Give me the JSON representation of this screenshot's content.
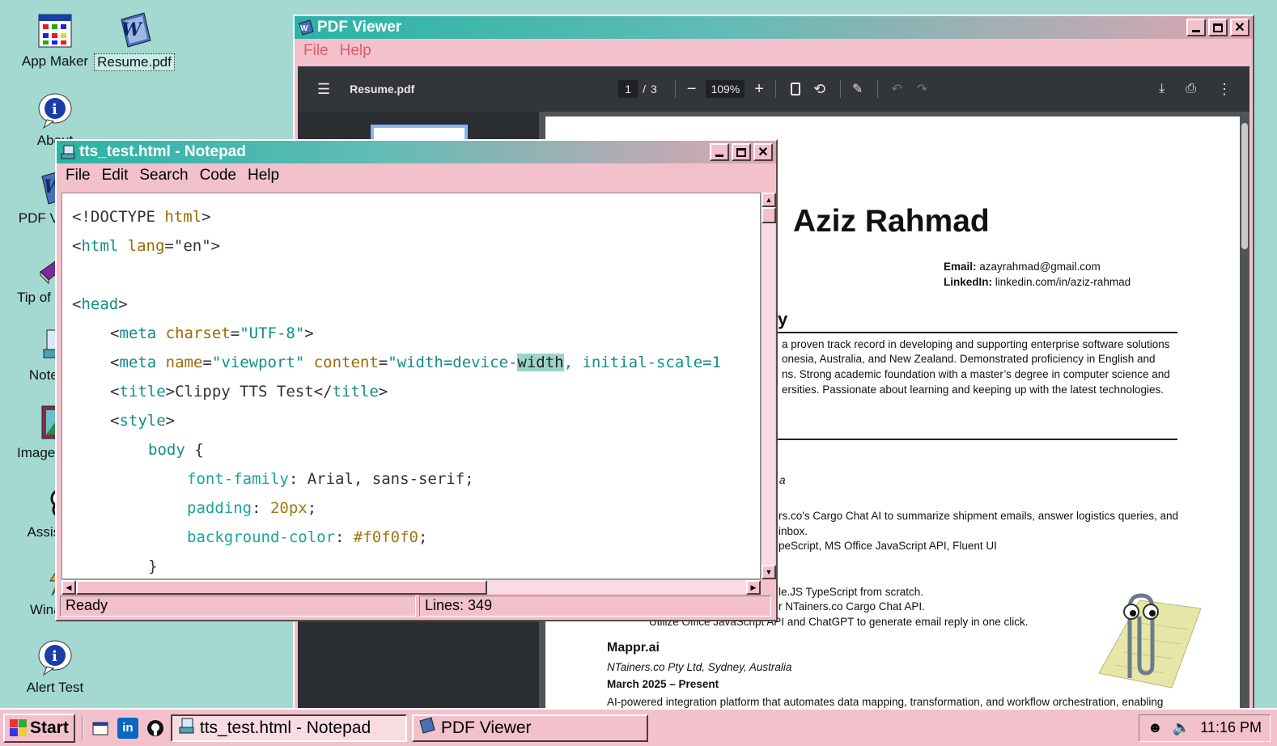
{
  "desktop": {
    "icons": [
      {
        "label": "App Maker"
      },
      {
        "label": "Resume.pdf"
      },
      {
        "label": "About"
      },
      {
        "label": "PDF Viewer"
      },
      {
        "label": "Tip of the Day"
      },
      {
        "label": "Notepad"
      },
      {
        "label": "Image Viewer"
      },
      {
        "label": "Assistant"
      },
      {
        "label": "Winamp"
      },
      {
        "label": "Alert Test"
      }
    ]
  },
  "pdf_viewer": {
    "title": "PDF Viewer",
    "menu": [
      "File",
      "Help"
    ],
    "toolbar": {
      "filename": "Resume.pdf",
      "page_current": "1",
      "page_sep": "/",
      "page_total": "3",
      "zoom": "109%",
      "zoom_out": "−",
      "zoom_in": "+"
    },
    "page": {
      "name": "Aziz Rahmad",
      "email_label": "Email:",
      "email": "azayrahmad@gmail.com",
      "linkedin_label": "LinkedIn:",
      "linkedin": "linkedin.com/in/aziz-rahmad",
      "summary_fragment": "y",
      "summary_lines": [
        "a proven track record in developing and supporting enterprise software solutions",
        "onesia, Australia, and New Zealand. Demonstrated proficiency in English and",
        "ns. Strong academic foundation with a master’s degree in computer science and",
        "ersities. Passionate about learning and keeping up with the latest technologies."
      ],
      "loc_fragment": "a",
      "exp1_lines": [
        "rs.co's Cargo Chat AI to summarize shipment emails, answer logistics queries, and",
        "inbox.",
        "peScript, MS Office JavaScript API, Fluent UI"
      ],
      "exp2_lines": [
        "le.JS TypeScript from scratch.",
        "r NTainers.co Cargo Chat API.",
        "Utilize Office JavaScript API and ChatGPT to generate email reply in one click."
      ],
      "job_title": "Mappr.ai",
      "job_company": "NTainers.co Pty Ltd, Sydney, Australia",
      "job_dates": "March 2025 – Present",
      "job_desc": "AI-powered integration platform that automates data mapping, transformation, and workflow orchestration, enabling"
    }
  },
  "notepad": {
    "title": "tts_test.html - Notepad",
    "menu": [
      "File",
      "Edit",
      "Search",
      "Code",
      "Help"
    ],
    "code": {
      "l1_a": "<!DOCTYPE ",
      "l1_b": "html",
      "l1_c": ">",
      "l2_a": "<",
      "l2_b": "html",
      "l2_c": " lang",
      "l2_d": "=",
      "l2_e": "\"en\"",
      "l2_f": ">",
      "l4_a": "<",
      "l4_b": "head",
      "l4_c": ">",
      "l5_a": "<",
      "l5_b": "meta",
      "l5_c": " charset",
      "l5_d": "=",
      "l5_e": "\"UTF-8\"",
      "l5_f": ">",
      "l6_a": "<",
      "l6_b": "meta",
      "l6_c": " name",
      "l6_d": "=",
      "l6_e": "\"viewport\"",
      "l6_f": " content",
      "l6_g": "=",
      "l6_h": "\"width=device-",
      "l6_i": "width",
      "l6_j": ", initial-scale=1",
      "l7_a": "<",
      "l7_b": "title",
      "l7_c": ">Clippy TTS Test</",
      "l7_d": "title",
      "l7_e": ">",
      "l8_a": "<",
      "l8_b": "style",
      "l8_c": ">",
      "l9_a": "body",
      "l9_b": " {",
      "l10_a": "font-family",
      "l10_b": ": Arial, sans-serif;",
      "l11_a": "padding",
      "l11_b": ": ",
      "l11_c": "20px",
      "l11_d": ";",
      "l12_a": "background-color",
      "l12_b": ": ",
      "l12_c": "#f0f0f0",
      "l12_d": ";",
      "l13_a": "}"
    },
    "status_left": "Ready",
    "status_right": "Lines: 349"
  },
  "taskbar": {
    "start": "Start",
    "tasks": [
      "tts_test.html - Notepad",
      "PDF Viewer"
    ],
    "clock": "11:16 PM"
  },
  "colors": {
    "desktop": "#a3d9d1",
    "window_face": "#f2c1cc",
    "title_start": "#2ab3a6",
    "title_end": "#e0a3b2"
  }
}
